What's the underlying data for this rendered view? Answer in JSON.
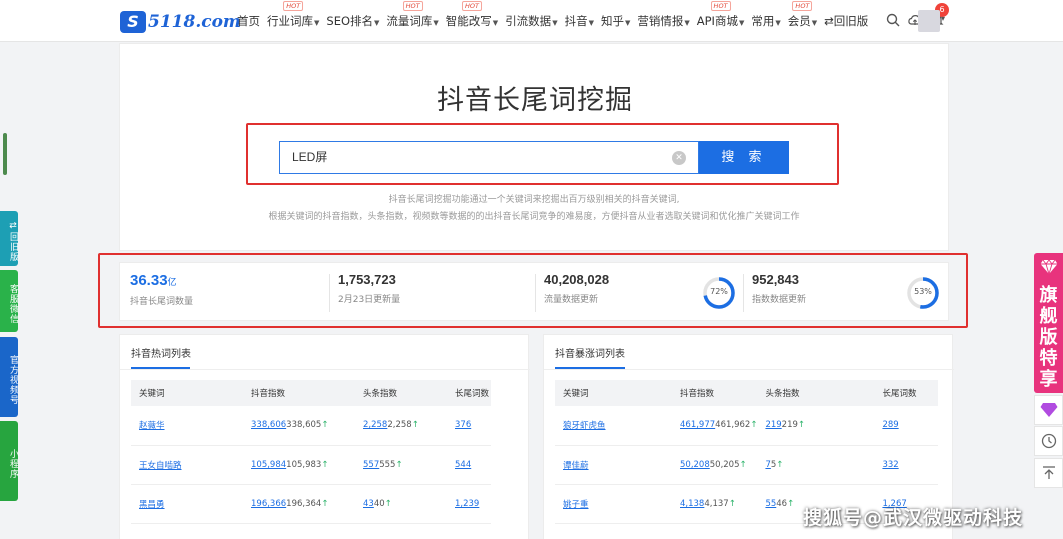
{
  "brand": {
    "logo_mark": "S",
    "logo_text": "5118.com"
  },
  "nav": {
    "items": [
      {
        "label": "首页",
        "caret": false,
        "hot": ""
      },
      {
        "label": "行业词库",
        "caret": true,
        "hot": "HOT"
      },
      {
        "label": "SEO排名",
        "caret": true,
        "hot": ""
      },
      {
        "label": "流量词库",
        "caret": true,
        "hot": "HOT"
      },
      {
        "label": "智能改写",
        "caret": true,
        "hot": "HOT"
      },
      {
        "label": "引流数据",
        "caret": true,
        "hot": ""
      },
      {
        "label": "抖音",
        "caret": true,
        "hot": ""
      },
      {
        "label": "知乎",
        "caret": true,
        "hot": ""
      },
      {
        "label": "营销情报",
        "caret": true,
        "hot": ""
      },
      {
        "label": "API商城",
        "caret": true,
        "hot": "HOT"
      },
      {
        "label": "常用",
        "caret": true,
        "hot": ""
      },
      {
        "label": "会员",
        "caret": true,
        "hot": "HOT"
      },
      {
        "label": "⇄回旧版",
        "caret": false,
        "hot": ""
      }
    ],
    "notification_count": "6"
  },
  "search": {
    "title": "抖音长尾词挖掘",
    "input_value": "LED屏",
    "button_label": "搜 索",
    "desc_line1": "抖音长尾词挖掘功能通过一个关键词来挖掘出百万级别相关的抖音关键词,",
    "desc_line2": "根据关键词的抖音指数，头条指数，视频数等数据的的出抖音长尾词竞争的难易度，方便抖音从业者选取关键词和优化推广关键词工作"
  },
  "stats": [
    {
      "value": "36.33",
      "unit": "亿",
      "label": "抖音长尾词数量"
    },
    {
      "value": "1,753,723",
      "unit": "",
      "label": "2月23日更新量"
    },
    {
      "value": "40,208,028",
      "unit": "",
      "label": "流量数据更新",
      "ring_percent": 72,
      "ring_label": "72%"
    },
    {
      "value": "952,843",
      "unit": "",
      "label": "指数数据更新",
      "ring_percent": 53,
      "ring_label": "53%"
    }
  ],
  "hot_list": {
    "title": "抖音热词列表",
    "columns": [
      "关键词",
      "抖音指数",
      "头条指数",
      "长尾词数"
    ],
    "rows": [
      {
        "keyword": "赵薇华",
        "douyin_link": "338,606",
        "douyin_prev": "338,605",
        "toutiao_link": "2,258",
        "toutiao_prev": "2,258",
        "longtail": "376"
      },
      {
        "keyword": "王女自啮路",
        "douyin_link": "105,984",
        "douyin_prev": "105,983",
        "toutiao_link": "557",
        "toutiao_prev": "555",
        "longtail": "544"
      },
      {
        "keyword": "黑昌勇",
        "douyin_link": "196,366",
        "douyin_prev": "196,364",
        "toutiao_link": "43",
        "toutiao_prev": "40",
        "longtail": "1,239"
      }
    ]
  },
  "surge_list": {
    "title": "抖音暴涨词列表",
    "columns": [
      "关键词",
      "抖音指数",
      "头条指数",
      "长尾词数"
    ],
    "rows": [
      {
        "keyword": "狼牙虾虎鱼",
        "douyin_link": "461,977",
        "douyin_prev": "461,962",
        "toutiao_link": "219",
        "toutiao_prev": "219",
        "longtail": "289"
      },
      {
        "keyword": "谭佳蔚",
        "douyin_link": "50,208",
        "douyin_prev": "50,205",
        "toutiao_link": "7",
        "toutiao_prev": "5",
        "longtail": "332"
      },
      {
        "keyword": "姚子重",
        "douyin_link": "4,138",
        "douyin_prev": "4,137",
        "toutiao_link": "55",
        "toutiao_prev": "46",
        "longtail": "1,267"
      }
    ]
  },
  "left_rail": [
    {
      "label": "⇄回旧版",
      "color": "#1d9fb4"
    },
    {
      "label": "客服微信",
      "color": "#2ab24a"
    },
    {
      "label": "官方视频号",
      "color": "#1a66c9"
    },
    {
      "label": "小程序",
      "color": "#27a53f"
    }
  ],
  "right_rail": {
    "flag_label": "旗舰版特享"
  },
  "watermark": "搜狐号@武汉微驱动科技",
  "colors": {
    "accent": "#1c6ee3",
    "highlight_box": "#e0302f",
    "flag": "#e8337d",
    "up_arrow": "#2db36b"
  }
}
